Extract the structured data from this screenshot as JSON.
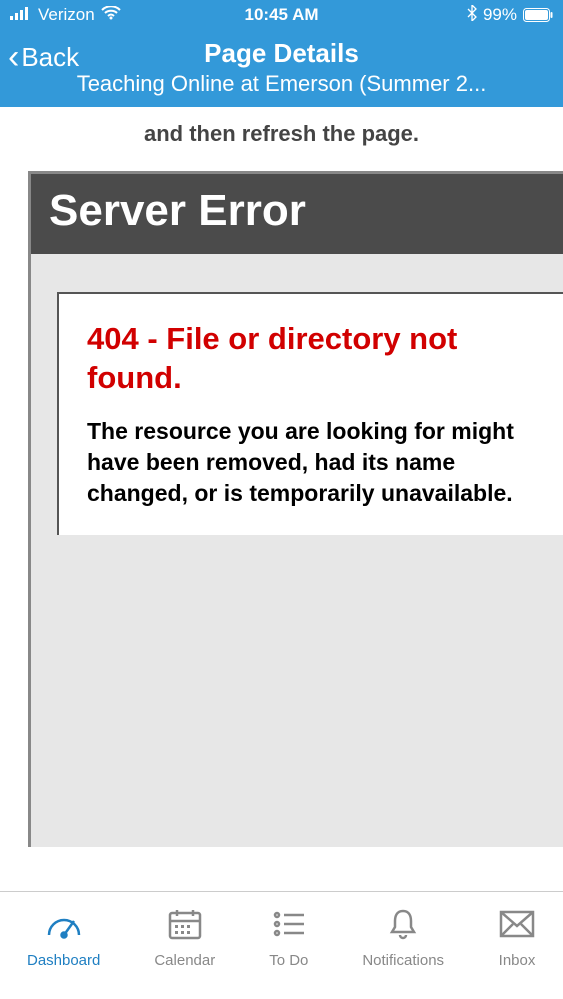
{
  "statusBar": {
    "carrier": "Verizon",
    "time": "10:45 AM",
    "batteryPercent": "99%"
  },
  "header": {
    "backLabel": "Back",
    "title": "Page Details",
    "subtitle": "Teaching Online at Emerson (Summer 2..."
  },
  "content": {
    "refreshLine": "and then refresh the page.",
    "serverErrorTitle": "Server Error",
    "errorCode": "404 - File or directory not found.",
    "errorDescription": "The resource you are looking for might have been removed, had its name changed, or is temporarily unavailable."
  },
  "tabs": {
    "dashboard": "Dashboard",
    "calendar": "Calendar",
    "todo": "To Do",
    "notifications": "Notifications",
    "inbox": "Inbox"
  }
}
